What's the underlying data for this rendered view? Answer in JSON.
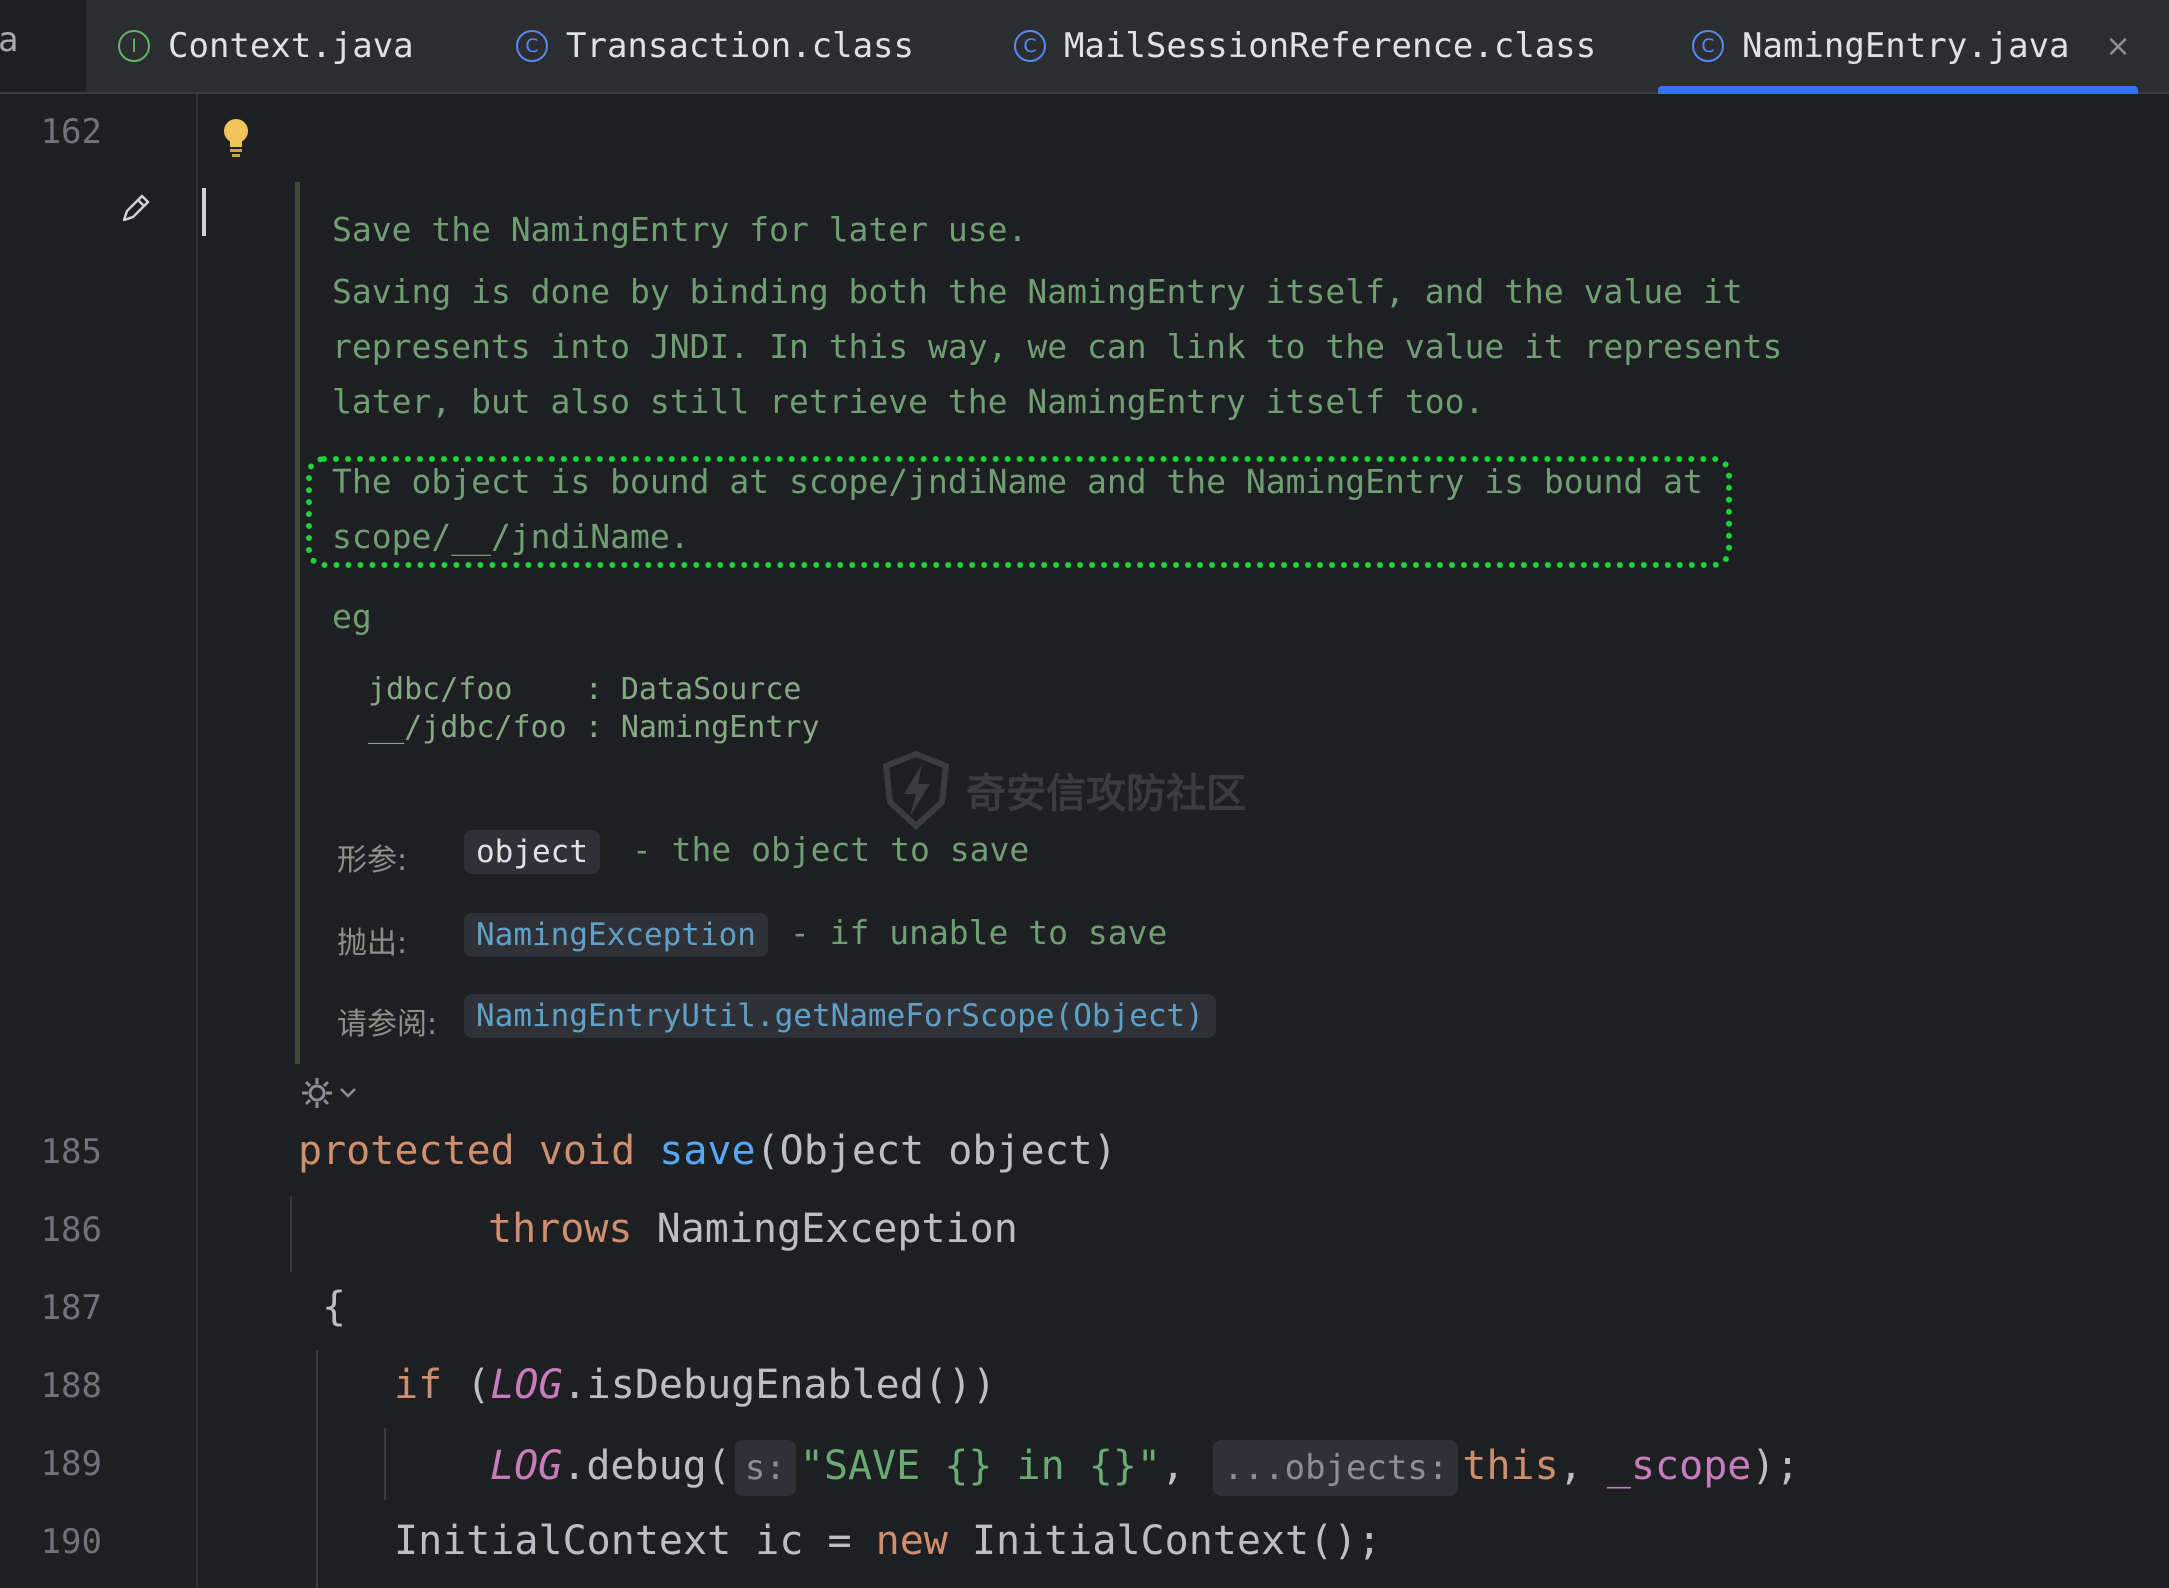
{
  "tabs": [
    {
      "label": "Context.java",
      "icon": "interface-icon",
      "icon_glyph": "I",
      "active": false
    },
    {
      "label": "Transaction.class",
      "icon": "class-icon",
      "icon_glyph": "C",
      "active": false
    },
    {
      "label": "MailSessionReference.class",
      "icon": "class-icon",
      "icon_glyph": "C",
      "active": false
    },
    {
      "label": "NamingEntry.java",
      "icon": "class-icon",
      "icon_glyph": "C",
      "active": true
    }
  ],
  "tab_fragment_left": "a",
  "tab_close_glyph": "×",
  "gutter": {
    "line_162": "162",
    "line_185": "185",
    "line_186": "186",
    "line_187": "187",
    "line_188": "188",
    "line_189": "189",
    "line_190": "190"
  },
  "doc": {
    "summary": "Save the NamingEntry for later use.",
    "p1_l1": "Saving is done by binding both the NamingEntry itself, and the value it",
    "p1_l2": "represents into JNDI. In this way, we can link to the value it represents",
    "p1_l3": "later, but also still retrieve the NamingEntry itself too.",
    "p2_l1": "The object is bound at scope/jndiName and the NamingEntry is bound at",
    "p2_l2": "scope/__/jndiName.",
    "eg": "eg",
    "pre_l1": "jdbc/foo    : DataSource",
    "pre_l2": "__/jdbc/foo : NamingEntry",
    "param_label": "形参:",
    "param_name": "object",
    "param_desc": " - the object to save",
    "throws_label": "抛出:",
    "throws_name": "NamingException",
    "throws_desc": " - if unable to save",
    "see_label": "请参阅:",
    "see_link": "NamingEntryUtil.getNameForScope(Object)"
  },
  "watermark": "奇安信攻防社区",
  "code": {
    "l185_kw1": "protected",
    "l185_kw2": "void",
    "l185_fn": "save",
    "l185_rest": "(Object object)",
    "l186_kw": "throws",
    "l186_rest": " NamingException",
    "l187": "{",
    "l188_kw": "if",
    "l188_open": " (",
    "l188_log": "LOG",
    "l188_rest": ".isDebugEnabled())",
    "l189_log": "LOG",
    "l189_call": ".debug(",
    "l189_hint1": "s:",
    "l189_str": "\"SAVE {} in {}\"",
    "l189_comma": ",",
    "l189_hint2": "...objects:",
    "l189_this": "this",
    "l189_sep": ", ",
    "l189_scope": "_scope",
    "l189_end": ");",
    "l190_a": "InitialContext ic = ",
    "l190_kw": "new",
    "l190_b": " InitialContext();"
  }
}
